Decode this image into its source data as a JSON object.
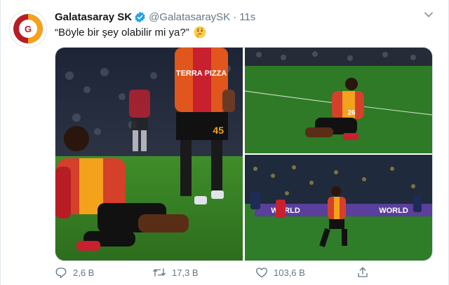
{
  "tweet": {
    "display_name": "Galatasaray SK",
    "handle": "@GalatasaraySK",
    "separator": "·",
    "time": "11s",
    "text": "“Böyle bir şey olabilir mi ya?”",
    "emoji": "thinking-face"
  },
  "photos": [
    {
      "sponsor": "TERRA PIZZA",
      "shirt_number": "45"
    },
    {
      "shirt_number": "26"
    },
    {
      "board_text_1": "WORLD",
      "board_text_2": "WORLD"
    }
  ],
  "actions": {
    "reply_count": "2,6 B",
    "retweet_count": "17,3 B",
    "like_count": "103,6 B"
  },
  "colors": {
    "gs_red": "#b81c25",
    "gs_yellow": "#f4a11c",
    "verified_blue": "#1da1f2",
    "muted_text": "#657786"
  }
}
